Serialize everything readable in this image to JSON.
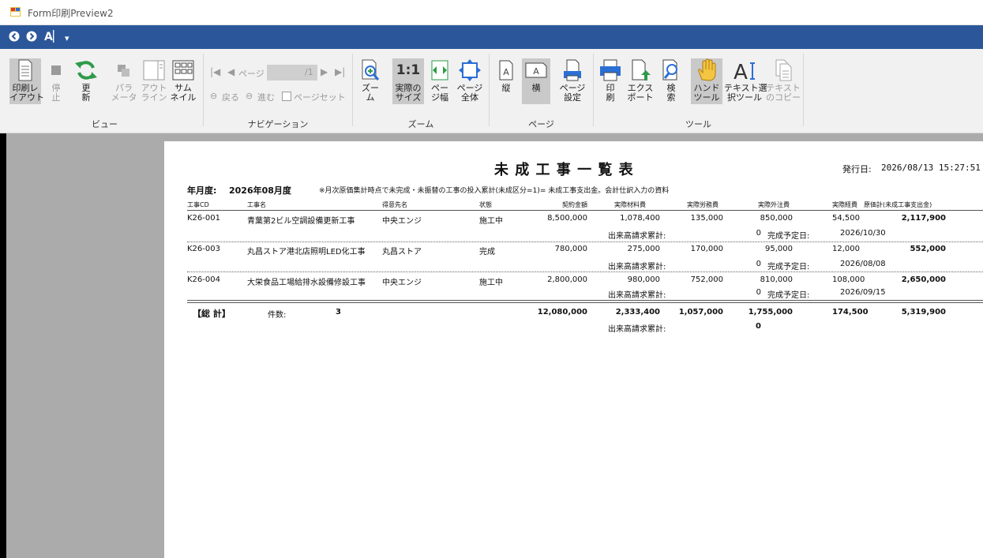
{
  "window": {
    "title": "Form印刷Preview2"
  },
  "quickbar": {
    "back_glyph": "◀",
    "forward_glyph": "▶",
    "text_tool": "A",
    "dropdown": "▾"
  },
  "ribbon": {
    "groups": [
      "ビュー",
      "ナビゲーション",
      "ズーム",
      "ページ",
      "ツール"
    ],
    "buttons": {
      "print_layout": "印刷レ\nイアウト",
      "stop": "停\n止",
      "refresh": "更\n新",
      "parameters": "パラ\nメータ",
      "outline": "アウト\nライン",
      "thumbnail": "サム\nネイル",
      "zoom": "ズー\nム",
      "actual_size_icon": "1:1",
      "actual_size": "実際の\nサイズ",
      "page_width": "ペー\nジ幅",
      "whole_page": "ページ\n全体",
      "portrait": "縦",
      "landscape": "横",
      "page_setup": "ページ\n設定",
      "print": "印\n刷",
      "export": "エクス\nポート",
      "search": "検\n索",
      "hand_tool": "ハンド\nツール",
      "text_select": "テキスト選\n択ツール",
      "text_copy": "テキスト\nのコピー"
    },
    "navigation": {
      "page_label": "ページ",
      "page_value": "",
      "page_total": "/1",
      "back": "戻る",
      "forward": "進む",
      "page_set": "ページセット"
    }
  },
  "report": {
    "title": "未 成 工 事 一 覧 表",
    "issue_label": "発行日:",
    "issue_date": "2026/08/13 15:27:51",
    "month_label": "年月度:",
    "month_value": "2026年08月度",
    "note": "※月次原価集計時点で未完成・未振替の工事の投入累計(未成区分=1)= 未成工事支出金。会計仕訳入力の資料",
    "headers": [
      "工事CD",
      "工事名",
      "得意先名",
      "状態",
      "契約金額",
      "実際材料費",
      "実際労務費",
      "実際外注費",
      "実際経費",
      "原価計(未成工事支出金)"
    ],
    "rows": [
      {
        "cd": "K26-001",
        "name": "青葉第2ビル空調設備更新工事",
        "client": "中央エンジ",
        "status": "施工中",
        "contract": "8,500,000",
        "material": "1,078,400",
        "labor": "135,000",
        "outsource": "850,000",
        "expense": "54,500",
        "total": "2,117,900",
        "billed_label": "出来高請求累計:",
        "billed": "0",
        "due_label": "完成予定日:",
        "due": "2026/10/30"
      },
      {
        "cd": "K26-003",
        "name": "丸昌ストア港北店照明LED化工事",
        "client": "丸昌ストア",
        "status": "完成",
        "contract": "780,000",
        "material": "275,000",
        "labor": "170,000",
        "outsource": "95,000",
        "expense": "12,000",
        "total": "552,000",
        "billed_label": "出来高請求累計:",
        "billed": "0",
        "due_label": "完成予定日:",
        "due": "2026/08/08"
      },
      {
        "cd": "K26-004",
        "name": "大栄食品工場給排水設備修設工事",
        "client": "中央エンジ",
        "status": "施工中",
        "contract": "2,800,000",
        "material": "980,000",
        "labor": "752,000",
        "outsource": "810,000",
        "expense": "108,000",
        "total": "2,650,000",
        "billed_label": "出来高請求累計:",
        "billed": "0",
        "due_label": "完成予定日:",
        "due": "2026/09/15"
      }
    ],
    "totals": {
      "label": "【総  計】",
      "count_label": "件数:",
      "count": "3",
      "contract": "12,080,000",
      "material": "2,333,400",
      "labor": "1,057,000",
      "outsource": "1,755,000",
      "expense": "174,500",
      "total": "5,319,900",
      "billed_label": "出来高請求累計:",
      "billed": "0"
    }
  }
}
